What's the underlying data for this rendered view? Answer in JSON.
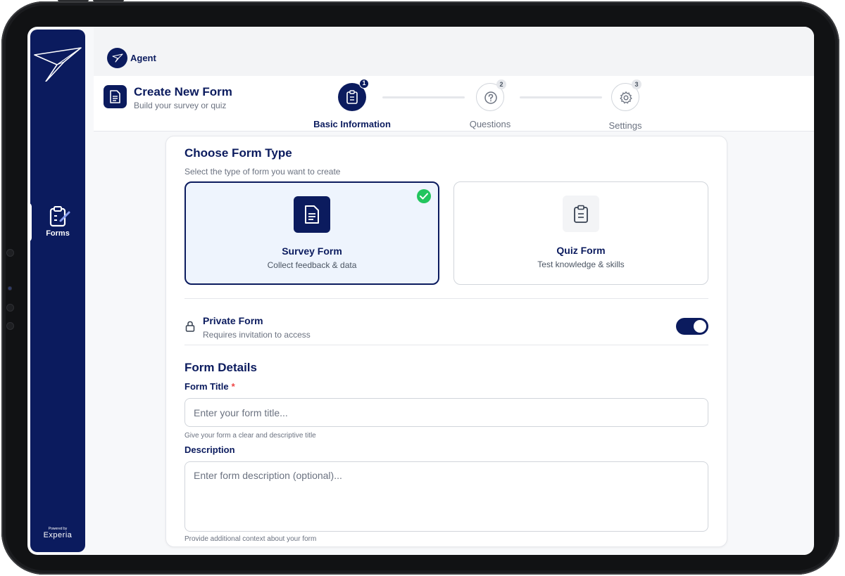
{
  "agent": {
    "name": "Agent"
  },
  "sidebar": {
    "items": [
      {
        "label": "Forms",
        "icon": "clipboard-check-icon",
        "active": true
      }
    ],
    "powered_by": "Powered by",
    "brand": "Experia"
  },
  "header": {
    "title": "Create New Form",
    "subtitle": "Build your survey or quiz"
  },
  "stepper": {
    "steps": [
      {
        "number": "1",
        "label": "Basic Information",
        "icon": "clipboard-icon",
        "state": "active"
      },
      {
        "number": "2",
        "label": "Questions",
        "icon": "question-circle-icon",
        "state": "pending"
      },
      {
        "number": "3",
        "label": "Settings",
        "icon": "gear-icon",
        "state": "pending"
      }
    ]
  },
  "form_type": {
    "title": "Choose Form Type",
    "subtitle": "Select the type of form you want to create",
    "options": [
      {
        "title": "Survey Form",
        "subtitle": "Collect feedback & data",
        "icon": "document-icon",
        "selected": true
      },
      {
        "title": "Quiz Form",
        "subtitle": "Test knowledge & skills",
        "icon": "clipboard-icon",
        "selected": false
      }
    ]
  },
  "private_form": {
    "title": "Private Form",
    "subtitle": "Requires invitation to access",
    "enabled": true
  },
  "form_details": {
    "title": "Form Details",
    "title_field": {
      "label": "Form Title",
      "required_mark": "*",
      "value": "",
      "placeholder": "Enter your form title...",
      "hint": "Give your form a clear and descriptive title"
    },
    "description_field": {
      "label": "Description",
      "value": "",
      "placeholder": "Enter form description (optional)...",
      "hint": "Provide additional context about your form"
    }
  },
  "colors": {
    "primary": "#0b1b5e",
    "success": "#22c55e",
    "required": "#ef4444",
    "selected_bg": "#eef4fd"
  }
}
